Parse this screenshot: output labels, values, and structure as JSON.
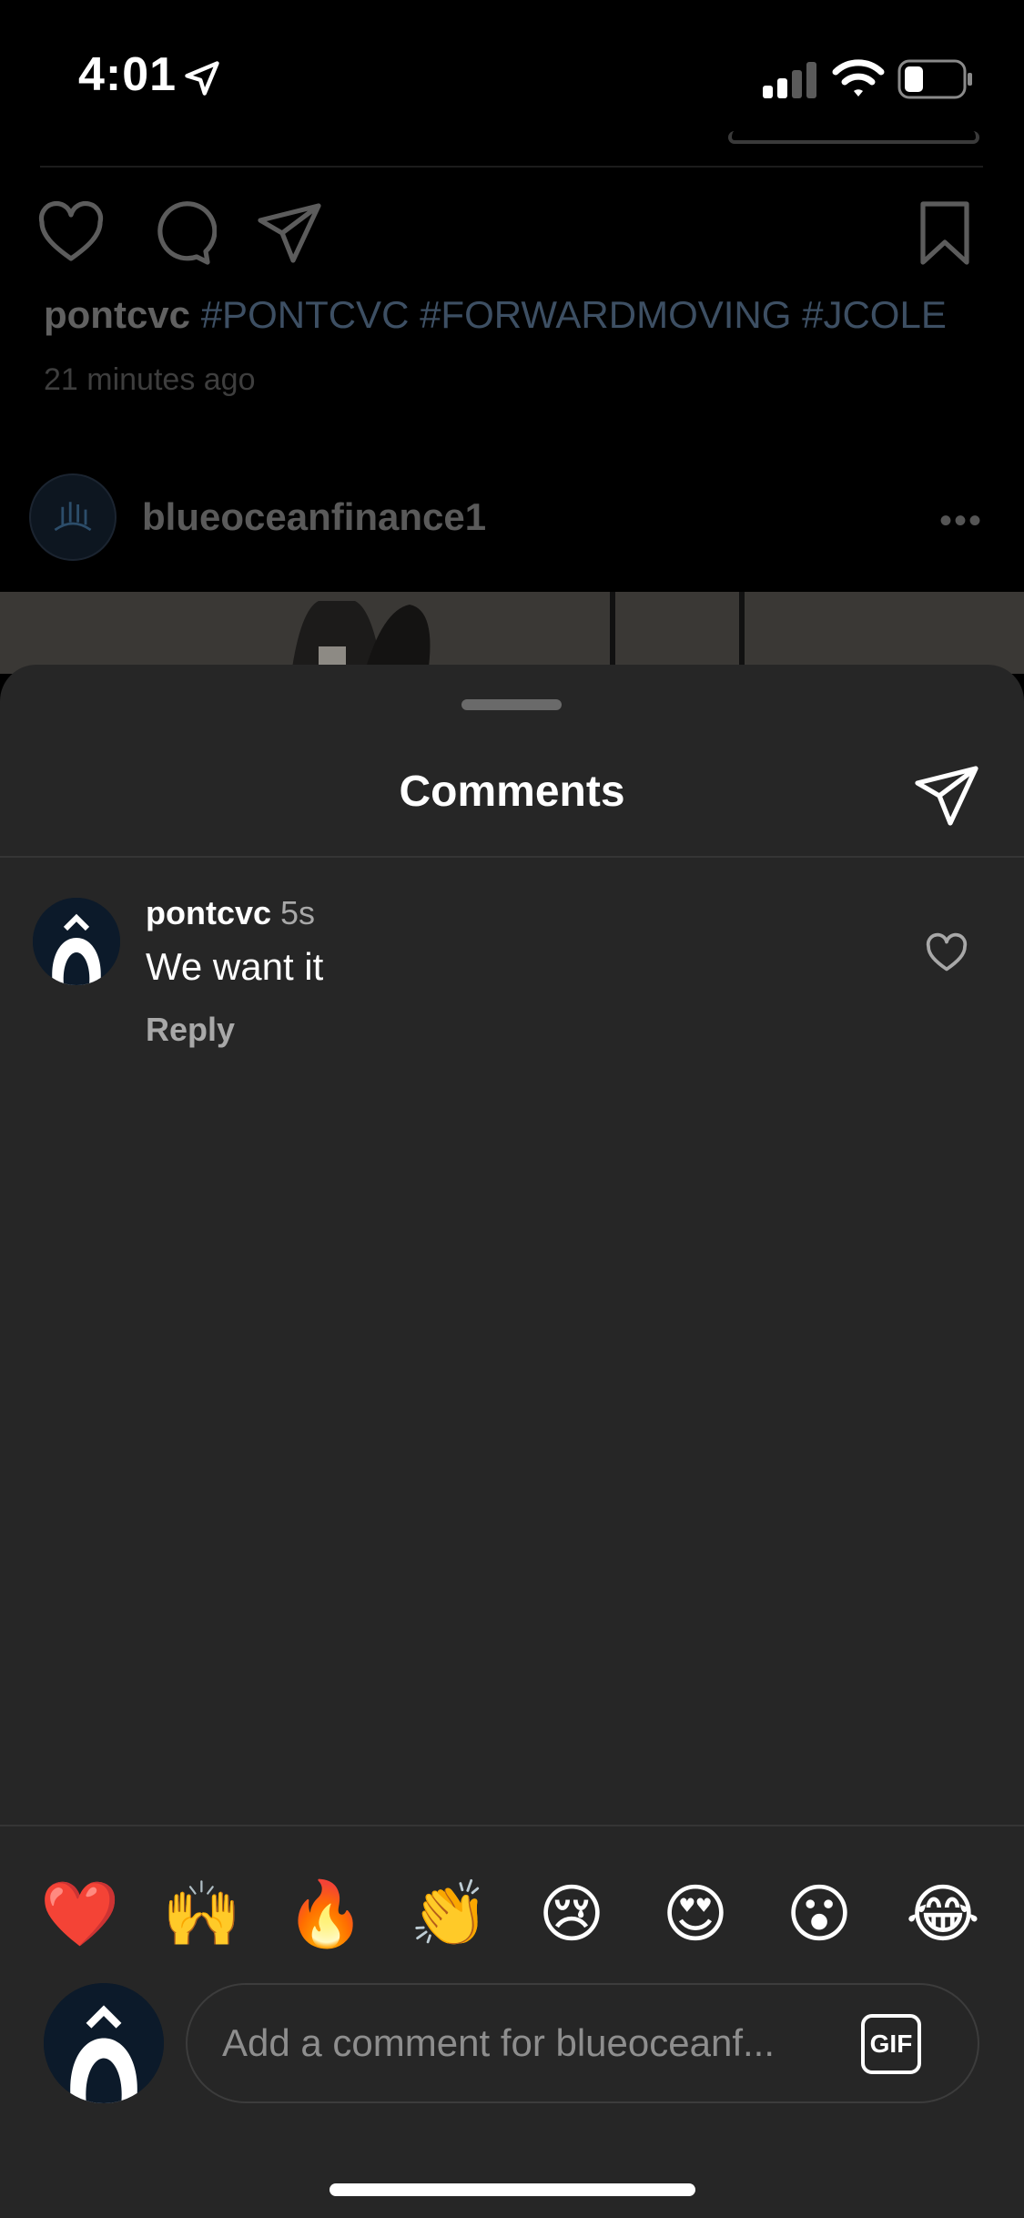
{
  "status_bar": {
    "time": "4:01"
  },
  "feed": {
    "caption_user": "pontcvc",
    "caption_tags": "#PONTCVC #FORWARDMOVING #JCOLE",
    "time_ago": "21 minutes ago",
    "next_post_user": "blueoceanfinance1",
    "more": "•••"
  },
  "comments_sheet": {
    "title": "Comments",
    "comments": [
      {
        "user": "pontcvc",
        "age": "5s",
        "text": "We want it",
        "reply_label": "Reply",
        "avatar_glyph": "Ô"
      }
    ]
  },
  "emoji_bar": [
    "❤️",
    "🙌",
    "🔥",
    "👏",
    "😢",
    "😍",
    "😮",
    "😂"
  ],
  "composer": {
    "avatar_glyph": "Ô",
    "placeholder": "Add a comment for blueoceanf...",
    "gif_label": "GIF"
  },
  "colors": {
    "sheet_bg": "#262626",
    "feed_bg": "#000000",
    "hashtag": "#3d4f63"
  }
}
